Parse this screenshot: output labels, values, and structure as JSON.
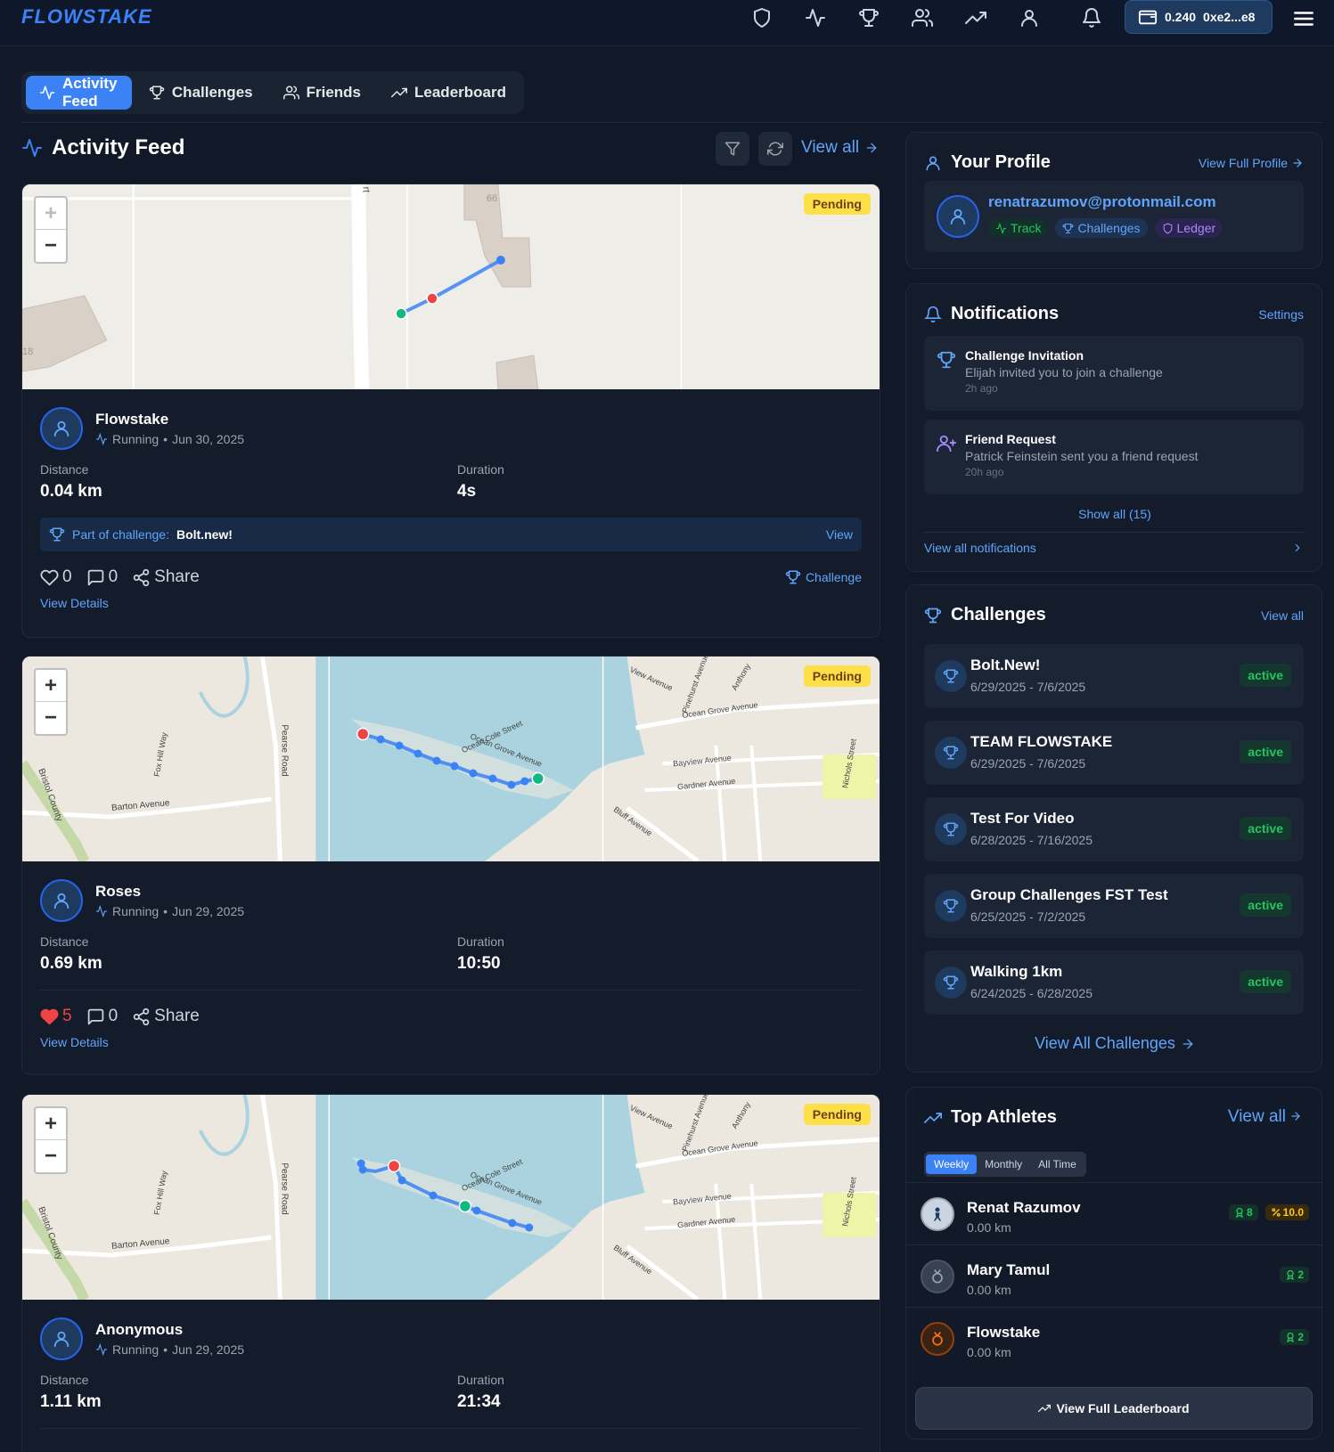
{
  "brand": "FLOWSTAKE",
  "topnav": {
    "icons": [
      "shield-icon",
      "activity-icon",
      "trophy-icon",
      "users-icon",
      "trending-up-icon",
      "user-icon",
      "bell-icon",
      "menu-icon"
    ],
    "wallet_balance": "0.240",
    "wallet_address": "0xe2...e8"
  },
  "tabs": [
    {
      "label": "Activity Feed",
      "icon": "activity-icon",
      "active": true
    },
    {
      "label": "Challenges",
      "icon": "trophy-icon",
      "active": false
    },
    {
      "label": "Friends",
      "icon": "users-icon",
      "active": false
    },
    {
      "label": "Leaderboard",
      "icon": "trending-up-icon",
      "active": false
    }
  ],
  "feed": {
    "title": "Activity Feed",
    "view_all": "View all",
    "status_label": "Pending",
    "distance_label": "Distance",
    "duration_label": "Duration",
    "share_label": "Share",
    "view_details": "View Details",
    "challenge_prefix": "Part of challenge:",
    "challenge_view": "View",
    "challenge_action": "Challenge",
    "activities": [
      {
        "user": "Flowstake",
        "type": "Running",
        "date": "Jun 30, 2025",
        "distance": "0.04 km",
        "duration": "4s",
        "likes": "0",
        "comments": "0",
        "liked": false,
        "challenge": "Bolt.new!"
      },
      {
        "user": "Roses",
        "type": "Running",
        "date": "Jun 29, 2025",
        "distance": "0.69 km",
        "duration": "10:50",
        "likes": "5",
        "comments": "0",
        "liked": true,
        "challenge": ""
      },
      {
        "user": "Anonymous",
        "type": "Running",
        "date": "Jun 29, 2025",
        "distance": "1.11 km",
        "duration": "21:34",
        "likes": "",
        "comments": "",
        "liked": false,
        "challenge": ""
      }
    ],
    "map_labels": {
      "map1": [
        "66",
        "18",
        "rt"
      ],
      "map2": [
        "Ocean Cole Street",
        "Ocean Grove Avenue",
        "Bayview Avenue",
        "Gardner Avenue",
        "Barton Avenue",
        "Pearse Road",
        "Fox Hill Way",
        "Bluff Avenue",
        "Nichols Street",
        "View Avenue",
        "Ocean Grove Avenue",
        "Bristol County",
        "Pinehurst Avenue",
        "Anthony"
      ]
    }
  },
  "profile": {
    "title": "Your Profile",
    "view_full": "View Full Profile",
    "email": "renatrazumov@protonmail.com",
    "pills": [
      {
        "label": "Track",
        "color": "#22c55e",
        "bg": "#14302a",
        "icon": "activity-icon"
      },
      {
        "label": "Challenges",
        "color": "#60a5fa",
        "bg": "#1e3354",
        "icon": "trophy-icon"
      },
      {
        "label": "Ledger",
        "color": "#a78bfa",
        "bg": "#2b2350",
        "icon": "shield-icon"
      }
    ]
  },
  "notifications": {
    "title": "Notifications",
    "settings": "Settings",
    "items": [
      {
        "icon": "trophy-icon",
        "title": "Challenge Invitation",
        "text": "Elijah invited you to join a challenge",
        "time": "2h ago"
      },
      {
        "icon": "user-plus-icon",
        "title": "Friend Request",
        "text": "Patrick Feinstein sent you a friend request",
        "time": "20h ago"
      }
    ],
    "show_all": "Show all (15)",
    "view_all": "View all notifications"
  },
  "challenges": {
    "title": "Challenges",
    "view_all": "View all",
    "items": [
      {
        "name": "Bolt.New!",
        "dates": "6/29/2025 - 7/6/2025",
        "status": "active"
      },
      {
        "name": "TEAM FLOWSTAKE",
        "dates": "6/29/2025 - 7/6/2025",
        "status": "active"
      },
      {
        "name": "Test For Video",
        "dates": "6/28/2025 - 7/16/2025",
        "status": "active"
      },
      {
        "name": "Group Challenges FST Test",
        "dates": "6/25/2025 - 7/2/2025",
        "status": "active"
      },
      {
        "name": "Walking 1km",
        "dates": "6/24/2025 - 6/28/2025",
        "status": "active"
      }
    ],
    "view_all_challenges": "View All Challenges"
  },
  "athletes": {
    "title": "Top Athletes",
    "view_all": "View all",
    "periods": [
      "Weekly",
      "Monthly",
      "All Time"
    ],
    "active_period": "Weekly",
    "items": [
      {
        "name": "Renat Razumov",
        "distance": "0.00 km",
        "trophies": "8",
        "points": "10.0"
      },
      {
        "name": "Mary Tamul",
        "distance": "0.00 km",
        "trophies": "2",
        "points": ""
      },
      {
        "name": "Flowstake",
        "distance": "0.00 km",
        "trophies": "2",
        "points": ""
      }
    ],
    "full_leaderboard": "View Full Leaderboard"
  },
  "colors": {
    "accent": "#3b82f6",
    "background": "#111827",
    "card": "#141c2c",
    "pending": "#fde047",
    "active": "#22c55e",
    "like": "#ef4444"
  }
}
